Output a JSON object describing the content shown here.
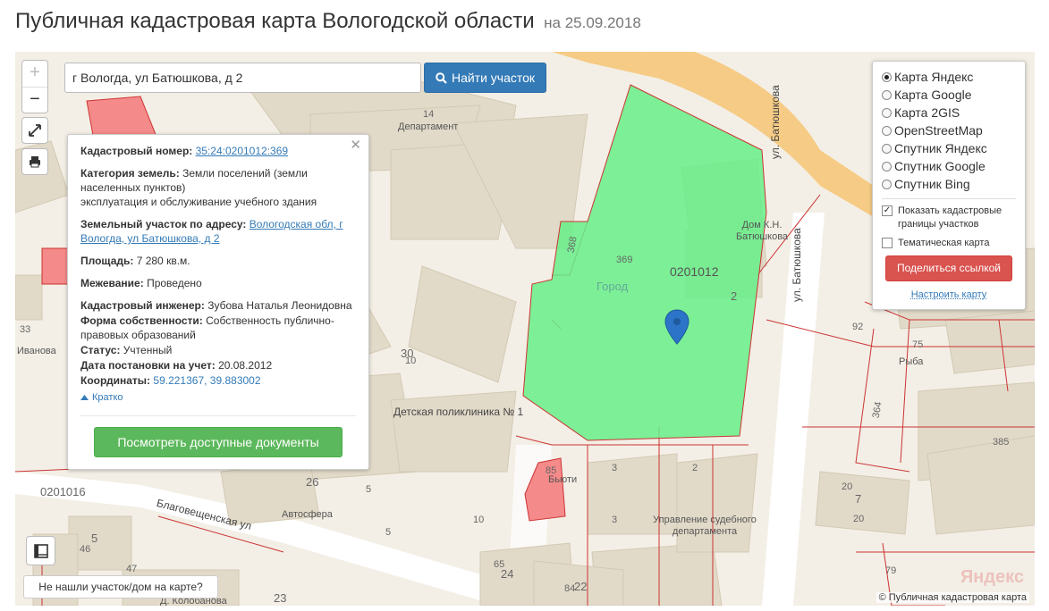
{
  "page": {
    "title": "Публичная кадастровая карта Вологодской области",
    "date": "на 25.09.2018"
  },
  "search": {
    "value": "г Вологда, ул Батюшкова, д 2",
    "button_label": "Найти участок"
  },
  "zoom": {
    "in_label": "+",
    "out_label": "−"
  },
  "parcel_info": {
    "cadastral_number_label": "Кадастровый номер:",
    "cadastral_number": "35:24:0201012:369",
    "land_category_label": "Категория земель:",
    "land_category": "Земли поселений (земли населенных пунктов)",
    "land_use": "эксплуатация и обслуживание учебного здания",
    "address_label": "Земельный участок по адресу:",
    "address": "Вологодская обл, г Вологда, ул Батюшкова, д 2",
    "area_label": "Площадь:",
    "area": "7 280 кв.м.",
    "survey_label": "Межевание:",
    "survey": "Проведено",
    "engineer_label": "Кадастровый инженер:",
    "engineer": "Зубова Наталья Леонидовна",
    "ownership_label": "Форма собственности:",
    "ownership": "Собственность публично-правовых образований",
    "status_label": "Статус:",
    "status": "Учтенный",
    "registration_date_label": "Дата постановки на учет:",
    "registration_date": "20.08.2012",
    "coordinates_label": "Координаты:",
    "coordinates": "59.221367, 39.883002",
    "collapse_label": "Кратко",
    "documents_button": "Посмотреть доступные документы"
  },
  "layers": {
    "options": [
      {
        "label": "Карта Яндекс",
        "selected": true
      },
      {
        "label": "Карта Google",
        "selected": false
      },
      {
        "label": "Карта 2GIS",
        "selected": false
      },
      {
        "label": "OpenStreetMap",
        "selected": false
      },
      {
        "label": "Спутник Яндекс",
        "selected": false
      },
      {
        "label": "Спутник Google",
        "selected": false
      },
      {
        "label": "Спутник Bing",
        "selected": false
      }
    ],
    "show_boundaries": {
      "label": "Показать кадастровые границы участков",
      "checked": true
    },
    "thematic_map": {
      "label": "Тематическая карта",
      "checked": false
    },
    "share_button": "Поделиться ссылкой",
    "configure_link": "Настроить карту"
  },
  "map_labels": {
    "departament": "Департамент",
    "house_batyushkov": "Дом К.Н. Батюшкова",
    "street_batyushkova_1": "ул. Батюшкова",
    "street_batyushkova_2": "ул. Батюшкова",
    "parcel_number": "369",
    "quarter_number": "0201012",
    "city_label": "Город",
    "num_2": "2",
    "num_368": "368",
    "num_14": "14",
    "num_30": "30",
    "num_10": "10",
    "polyclinic": "Детская поликлиника № 1",
    "ivanova": "Иванова",
    "num_33": "33",
    "quarter_0201016": "0201016",
    "street_blagoveshchenskaya": "Благовещенская ул",
    "num_26": "26",
    "autosfera": "Автосфера",
    "num_5a": "5",
    "num_5b": "5",
    "num_46": "46",
    "num_47": "47",
    "num_23": "23",
    "kolobanova": "Д. Колобанова",
    "num_85": "85",
    "byuti": "Бьюти",
    "num_3": "3",
    "num_2b": "2",
    "court_admin": "Управление судебного департамента",
    "num_65": "65",
    "num_24": "24",
    "num_84": "84",
    "num_22": "22",
    "num_92": "92",
    "num_75": "75",
    "ryba": "Рыба",
    "num_364": "364",
    "num_385": "385",
    "num_20a": "20",
    "num_7": "7",
    "num_20b": "20",
    "num_79": "79",
    "num_10b": "10"
  },
  "footer": {
    "not_found_button": "Не нашли участок/дом на карте?",
    "copyright": "© Публичная кадастровая карта",
    "watermark": "Яндекс"
  },
  "colors": {
    "parcel_fill": "#66ee88",
    "parcel_border": "#cc3333",
    "primary": "#337ab7",
    "success": "#5cb85c",
    "danger": "#d9534f",
    "road_orange": "#f6cb85",
    "building": "#e2dac9",
    "highlight_red": "#f58a8a"
  },
  "icons": [
    "search-icon",
    "fullscreen-icon",
    "print-icon",
    "legend-icon",
    "map-pin-icon",
    "close-icon",
    "caret-up-icon"
  ]
}
